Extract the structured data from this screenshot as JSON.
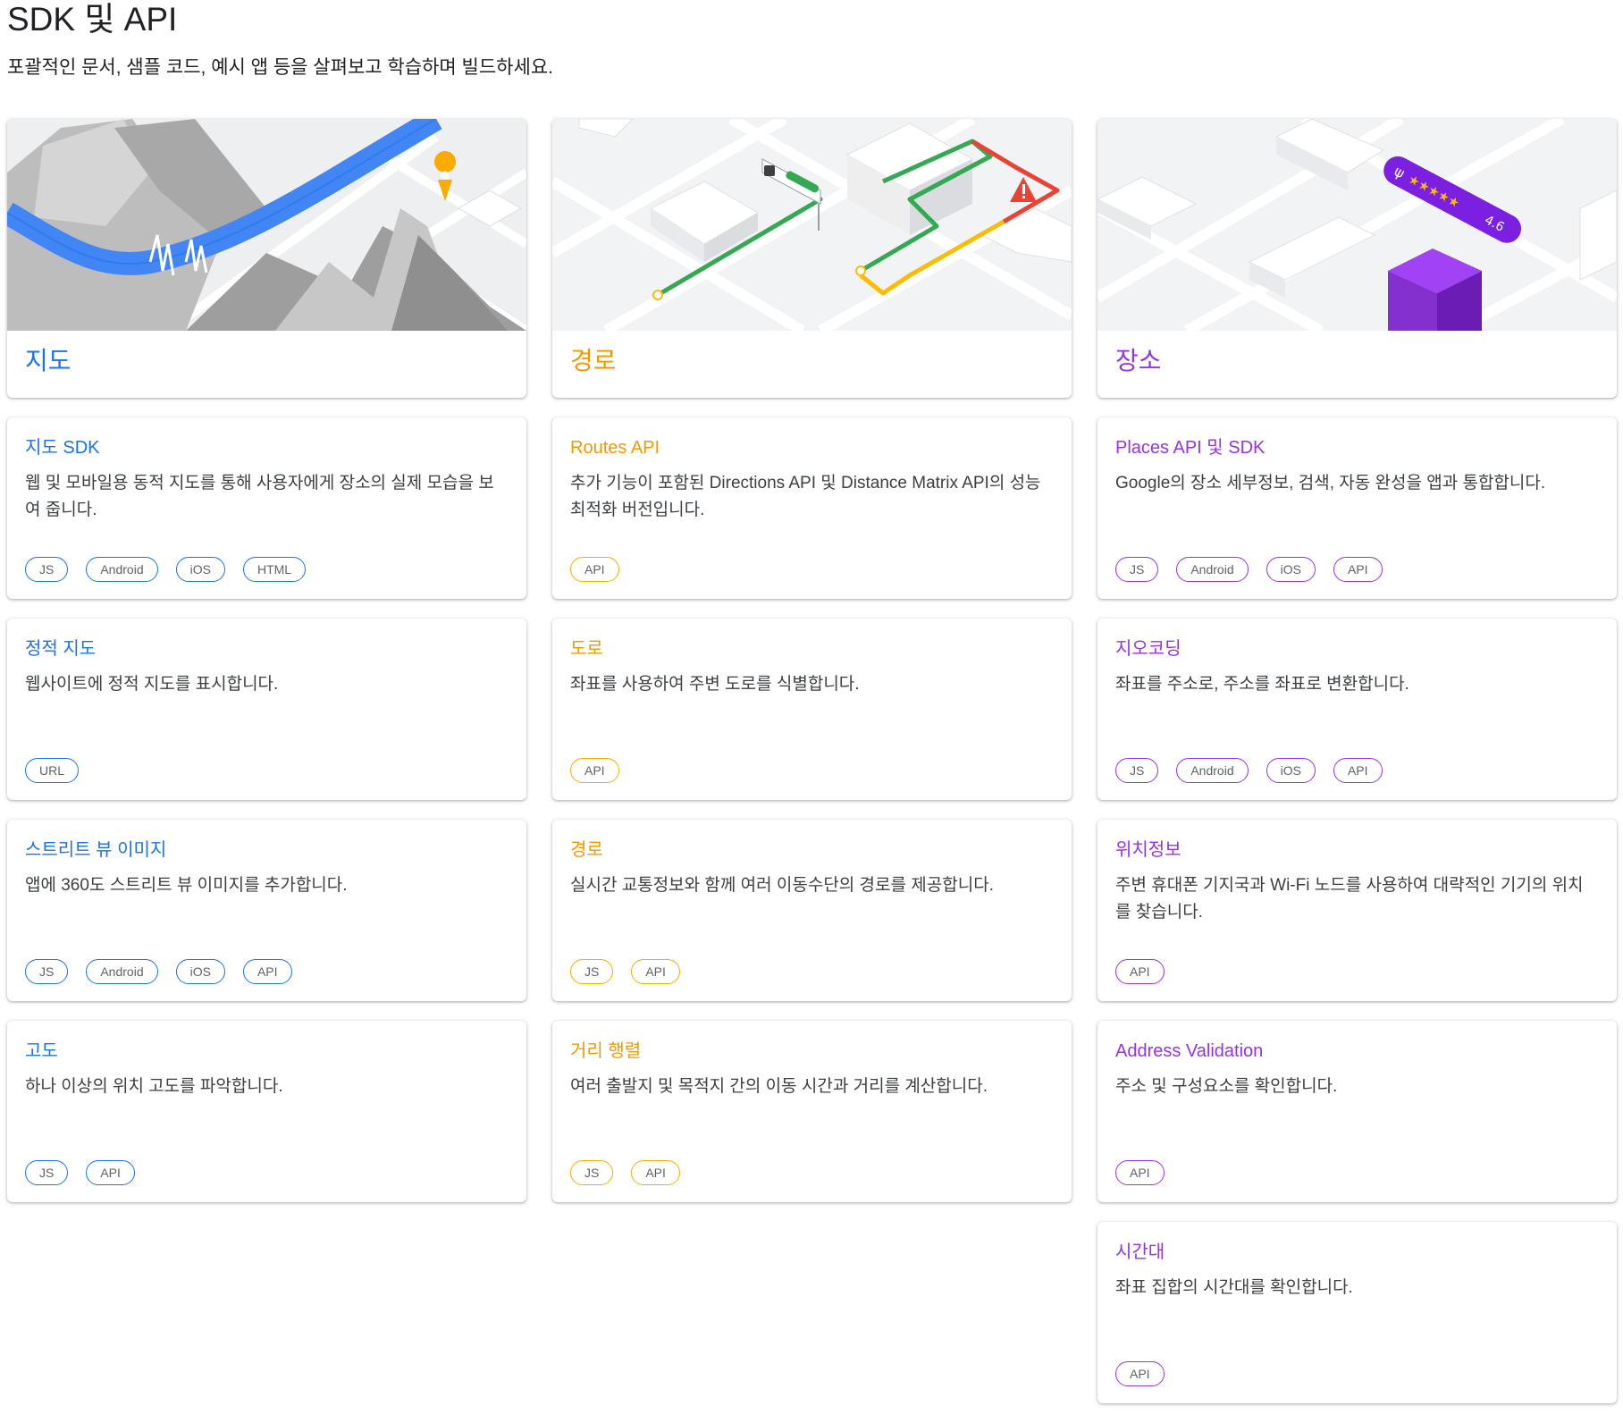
{
  "header": {
    "title": "SDK 및 API",
    "subtitle": "포괄적인 문서, 샘플 코드, 예시 앱 등을 살펴보고 학습하며 빌드하세요."
  },
  "colors": {
    "maps": "#1a73e8",
    "routes": "#f29900",
    "places": "#9334e6"
  },
  "columns": [
    {
      "hero_title": "지도",
      "accent": "blue",
      "cards": [
        {
          "title": "지도 SDK",
          "description": "웹 및 모바일용 동적 지도를 통해 사용자에게 장소의 실제 모습을 보여 줍니다.",
          "chips": [
            "JS",
            "Android",
            "iOS",
            "HTML"
          ]
        },
        {
          "title": "정적 지도",
          "description": "웹사이트에 정적 지도를 표시합니다.",
          "chips": [
            "URL"
          ]
        },
        {
          "title": "스트리트 뷰 이미지",
          "description": "앱에 360도 스트리트 뷰 이미지를 추가합니다.",
          "chips": [
            "JS",
            "Android",
            "iOS",
            "API"
          ]
        },
        {
          "title": "고도",
          "description": "하나 이상의 위치 고도를 파악합니다.",
          "chips": [
            "JS",
            "API"
          ]
        }
      ]
    },
    {
      "hero_title": "경로",
      "accent": "orange",
      "cards": [
        {
          "title": "Routes API",
          "description": "추가 기능이 포함된 Directions API 및 Distance Matrix API의 성능 최적화 버전입니다.",
          "chips": [
            "API"
          ]
        },
        {
          "title": "도로",
          "description": "좌표를 사용하여 주변 도로를 식별합니다.",
          "chips": [
            "API"
          ]
        },
        {
          "title": "경로",
          "description": "실시간 교통정보와 함께 여러 이동수단의 경로를 제공합니다.",
          "chips": [
            "JS",
            "API"
          ]
        },
        {
          "title": "거리 행렬",
          "description": "여러 출발지 및 목적지 간의 이동 시간과 거리를 계산합니다.",
          "chips": [
            "JS",
            "API"
          ]
        }
      ]
    },
    {
      "hero_title": "장소",
      "accent": "purple",
      "rating_badge": "4.6",
      "cards": [
        {
          "title": "Places API 및 SDK",
          "description": "Google의 장소 세부정보, 검색, 자동 완성을 앱과 통합합니다.",
          "chips": [
            "JS",
            "Android",
            "iOS",
            "API"
          ]
        },
        {
          "title": "지오코딩",
          "description": "좌표를 주소로, 주소를 좌표로 변환합니다.",
          "chips": [
            "JS",
            "Android",
            "iOS",
            "API"
          ]
        },
        {
          "title": "위치정보",
          "description": "주변 휴대폰 기지국과 Wi-Fi 노드를 사용하여 대략적인 기기의 위치를 찾습니다.",
          "chips": [
            "API"
          ]
        },
        {
          "title": "Address Validation",
          "description": "주소 및 구성요소를 확인합니다.",
          "chips": [
            "API"
          ]
        },
        {
          "title": "시간대",
          "description": "좌표 집합의 시간대를 확인합니다.",
          "chips": [
            "API"
          ]
        }
      ]
    }
  ]
}
